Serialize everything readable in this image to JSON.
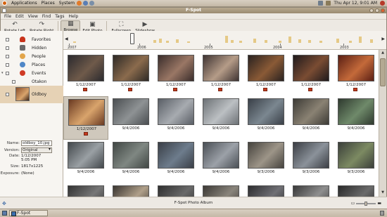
{
  "top_panel": {
    "menus": [
      "Applications",
      "Places",
      "System"
    ],
    "clock": "Thu Apr 12,  9:01 AM"
  },
  "window": {
    "title": "F-Spot",
    "menubar": [
      "File",
      "Edit",
      "View",
      "Find",
      "Tags",
      "Help"
    ],
    "toolbar": {
      "rotate_left": "Rotate Left",
      "rotate_right": "Rotate Right",
      "browse": "Browse",
      "edit_photo": "Edit Photo",
      "fullscreen": "Fullscreen",
      "slideshow": "Slideshow"
    }
  },
  "timeline": {
    "years": [
      "2007",
      "2006",
      "2005",
      "2004",
      "2003"
    ]
  },
  "tags": [
    {
      "label": "Favorites",
      "icon": "heart-icon",
      "color": "#c8331b"
    },
    {
      "label": "Hidden",
      "icon": "hidden-icon",
      "color": "#6a6a6a"
    },
    {
      "label": "People",
      "icon": "people-icon",
      "color": "#e2a54a"
    },
    {
      "label": "Places",
      "icon": "places-icon",
      "color": "#4f87c7"
    },
    {
      "label": "Events",
      "icon": "events-icon",
      "color": "#cf3a24"
    },
    {
      "label": "Otakon",
      "icon": "",
      "color": ""
    },
    {
      "label": "Oldboy",
      "icon": "photo-thumb",
      "color": ""
    }
  ],
  "info": {
    "name_label": "Name:",
    "name_value": "oldboy_10.jpg",
    "version_label": "Version:",
    "version_value": "Original",
    "date_label": "Date:",
    "date_value_1": "1/12/2007",
    "date_value_2": "5:05 PM",
    "size_label": "Size:",
    "size_value": "1817x1225",
    "exposure_label": "Exposure:",
    "exposure_value": "(None)"
  },
  "photos": [
    {
      "date": "1/12/2007",
      "tagged": true
    },
    {
      "date": "1/12/2007",
      "tagged": true
    },
    {
      "date": "1/12/2007",
      "tagged": true
    },
    {
      "date": "1/12/2007",
      "tagged": true
    },
    {
      "date": "1/12/2007",
      "tagged": true
    },
    {
      "date": "1/12/2007",
      "tagged": true
    },
    {
      "date": "1/12/2007",
      "tagged": true
    },
    {
      "date": "1/12/2007",
      "tagged": true,
      "selected": true
    },
    {
      "date": "9/4/2006",
      "tagged": false
    },
    {
      "date": "9/4/2006",
      "tagged": false
    },
    {
      "date": "9/4/2006",
      "tagged": false
    },
    {
      "date": "9/4/2006",
      "tagged": false
    },
    {
      "date": "9/4/2006",
      "tagged": false
    },
    {
      "date": "9/4/2006",
      "tagged": false
    },
    {
      "date": "9/4/2006",
      "tagged": false
    },
    {
      "date": "9/4/2006",
      "tagged": false
    },
    {
      "date": "9/4/2006",
      "tagged": false
    },
    {
      "date": "9/4/2006",
      "tagged": false
    },
    {
      "date": "9/3/2006",
      "tagged": false
    },
    {
      "date": "9/3/2006",
      "tagged": false
    },
    {
      "date": "9/3/2006",
      "tagged": false
    },
    {
      "date": "",
      "tagged": false
    },
    {
      "date": "",
      "tagged": false
    },
    {
      "date": "",
      "tagged": false
    },
    {
      "date": "",
      "tagged": false
    },
    {
      "date": "",
      "tagged": false
    },
    {
      "date": "",
      "tagged": false
    },
    {
      "date": "",
      "tagged": false
    }
  ],
  "status": {
    "text": "F-Spot Photo Album"
  },
  "taskbar": {
    "task_label": "F-Spot"
  }
}
